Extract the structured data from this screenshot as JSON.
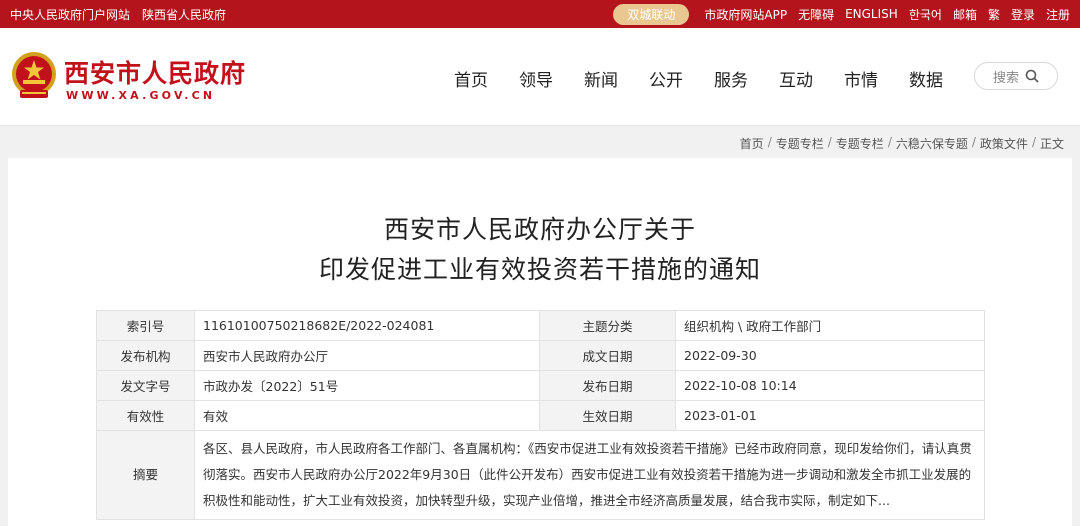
{
  "topbar": {
    "left_links": [
      "中央人民政府门户网站",
      "陕西省人民政府"
    ],
    "linkage_pill": "双城联动",
    "right_links": [
      "市政府网站APP",
      "无障碍",
      "ENGLISH",
      "한국어",
      "邮箱",
      "繁",
      "登录",
      "注册"
    ]
  },
  "header": {
    "site_title": "西安市人民政府",
    "site_domain": "WWW.XA.GOV.CN",
    "nav": [
      "首页",
      "领导",
      "新闻",
      "公开",
      "服务",
      "互动",
      "市情",
      "数据"
    ],
    "search_label": "搜索"
  },
  "breadcrumb": [
    "首页",
    "专题专栏",
    "专题专栏",
    "六稳六保专题",
    "政策文件",
    "正文"
  ],
  "article": {
    "title_line1": "西安市人民政府办公厅关于",
    "title_line2": "印发促进工业有效投资若干措施的通知"
  },
  "meta": {
    "index_label": "索引号",
    "index_value": "11610100750218682E/2022-024081",
    "topic_label": "主题分类",
    "topic_value": "组织机构 \\ 政府工作部门",
    "issuer_label": "发布机构",
    "issuer_value": "西安市人民政府办公厅",
    "created_label": "成文日期",
    "created_value": "2022-09-30",
    "docno_label": "发文字号",
    "docno_value": "市政办发〔2022〕51号",
    "published_label": "发布日期",
    "published_value": "2022-10-08 10:14",
    "validity_label": "有效性",
    "validity_value": "有效",
    "effective_label": "生效日期",
    "effective_value": "2023-01-01",
    "abstract_label": "摘要",
    "abstract_value": "各区、县人民政府，市人民政府各工作部门、各直属机构：《西安市促进工业有效投资若干措施》已经市政府同意，现印发给你们，请认真贯彻落实。西安市人民政府办公厅2022年9月30日（此件公开发布）西安市促进工业有效投资若干措施为进一步调动和激发全市抓工业发展的积极性和能动性，扩大工业有效投资，加快转型升级，实现产业倍增，推进全市经济高质量发展，结合我市实际，制定如下..."
  },
  "colors": {
    "brand_red": "#b4141b",
    "title_red": "#c1121c",
    "pill_gold": "#e8c890"
  },
  "icons": {
    "logo": "national-emblem-icon",
    "search": "search-icon"
  }
}
